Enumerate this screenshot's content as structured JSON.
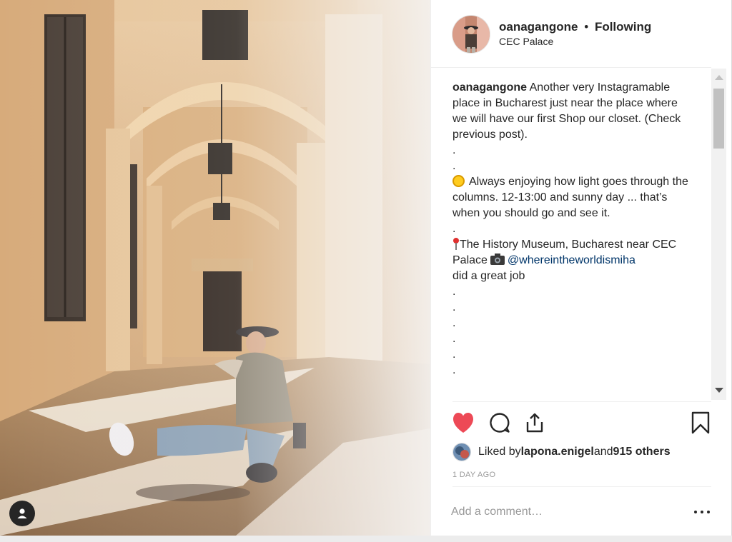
{
  "post": {
    "username": "oanagangone",
    "separator": "•",
    "follow_status": "Following",
    "location": "CEC Palace"
  },
  "caption": {
    "username": "oanagangone",
    "text1": " Another very Instagramable place in Bucharest just near the place where we will have our first Shop our closet. (Check previous post).",
    "dot1": ".",
    "dot2": ".",
    "sun_text": "Always enjoying how light goes through the columns. 12-13:00 and sunny day ... that’s when you should go and see it.",
    "dot3": ".",
    "place_text": "The History Museum, Bucharest near CEC Palace",
    "mention": "@whereintheworldismiha",
    "credit_text": "did a great job",
    "dot4": ".",
    "dot5": ".",
    "dot6": ".",
    "dot7": ".",
    "dot8": ".",
    "dot9": "."
  },
  "likes": {
    "prefix": "Liked by ",
    "user": "lapona.enigel",
    "and": " and ",
    "others": "915 others"
  },
  "timestamp": "1 DAY AGO",
  "comment": {
    "placeholder": "Add a comment…"
  },
  "icons": {
    "like": "heart-icon",
    "comment": "speech-bubble-icon",
    "share": "share-icon",
    "save": "bookmark-icon",
    "tags": "person-icon",
    "more": "ellipsis-icon"
  },
  "colors": {
    "like": "#ed4956",
    "mention": "#003569",
    "meta": "#999999"
  }
}
